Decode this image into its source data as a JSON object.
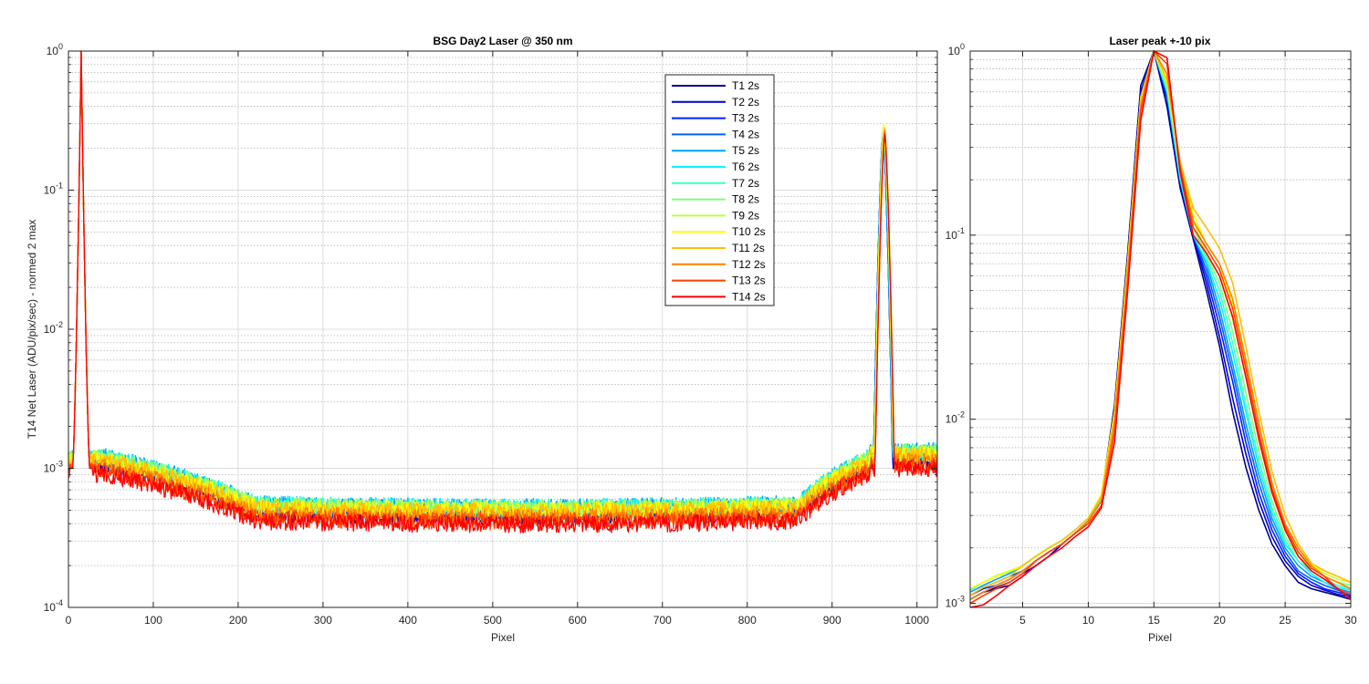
{
  "chart_data": [
    {
      "type": "line",
      "title": "BSG  Day2 Laser @ 350 nm",
      "xlabel": "Pixel",
      "ylabel": "T14 Net Laser (ADU/pix/sec) - normed 2 max",
      "xlim": [
        0,
        1024
      ],
      "ylim": [
        0.0001,
        1
      ],
      "yscale": "log",
      "grid": true,
      "minor_grid": true,
      "xticks": [
        0,
        100,
        200,
        300,
        400,
        500,
        600,
        700,
        800,
        900,
        1000
      ],
      "yticks": [
        {
          "base": "10",
          "exp": "-4",
          "value": 0.0001
        },
        {
          "base": "10",
          "exp": "-3",
          "value": 0.001
        },
        {
          "base": "10",
          "exp": "-2",
          "value": 0.01
        },
        {
          "base": "10",
          "exp": "-1",
          "value": 0.1
        },
        {
          "base": "10",
          "exp": "0",
          "value": 1
        }
      ],
      "legend_position": "top-center",
      "series": [
        {
          "name": "T1 2s",
          "color": "#00008f",
          "peak1_x": 15,
          "peak2_x": 960,
          "peak2_y": 0.25,
          "floor_y": 0.00048
        },
        {
          "name": "T2 2s",
          "color": "#0000cf",
          "peak1_x": 15,
          "peak2_x": 960,
          "peak2_y": 0.26,
          "floor_y": 0.0005
        },
        {
          "name": "T3 2s",
          "color": "#0020ff",
          "peak1_x": 15,
          "peak2_x": 960,
          "peak2_y": 0.25,
          "floor_y": 0.00052
        },
        {
          "name": "T4 2s",
          "color": "#0060ff",
          "peak1_x": 15,
          "peak2_x": 960,
          "peak2_y": 0.26,
          "floor_y": 0.00054
        },
        {
          "name": "T5 2s",
          "color": "#00a0ff",
          "peak1_x": 15,
          "peak2_x": 960,
          "peak2_y": 0.25,
          "floor_y": 0.00056
        },
        {
          "name": "T6 2s",
          "color": "#10f0ff",
          "peak1_x": 15,
          "peak2_x": 961,
          "peak2_y": 0.26,
          "floor_y": 0.00056
        },
        {
          "name": "T7 2s",
          "color": "#40ffbf",
          "peak1_x": 15,
          "peak2_x": 961,
          "peak2_y": 0.25,
          "floor_y": 0.00055
        },
        {
          "name": "T8 2s",
          "color": "#80ff7f",
          "peak1_x": 15,
          "peak2_x": 961,
          "peak2_y": 0.26,
          "floor_y": 0.00055
        },
        {
          "name": "T9 2s",
          "color": "#bfff40",
          "peak1_x": 15,
          "peak2_x": 961,
          "peak2_y": 0.27,
          "floor_y": 0.00054
        },
        {
          "name": "T10 2s",
          "color": "#ffff00",
          "peak1_x": 15,
          "peak2_x": 961,
          "peak2_y": 0.3,
          "floor_y": 0.00053
        },
        {
          "name": "T11 2s",
          "color": "#ffbf00",
          "peak1_x": 15,
          "peak2_x": 962,
          "peak2_y": 0.28,
          "floor_y": 0.00052
        },
        {
          "name": "T12 2s",
          "color": "#ff8000",
          "peak1_x": 15,
          "peak2_x": 962,
          "peak2_y": 0.27,
          "floor_y": 0.00047
        },
        {
          "name": "T13 2s",
          "color": "#ff4000",
          "peak1_x": 15,
          "peak2_x": 962,
          "peak2_y": 0.26,
          "floor_y": 0.00044
        },
        {
          "name": "T14 2s",
          "color": "#ff0000",
          "peak1_x": 15,
          "peak2_x": 962,
          "peak2_y": 0.25,
          "floor_y": 0.00042
        }
      ]
    },
    {
      "type": "line",
      "title": "Laser peak +-10 pix",
      "xlabel": "Pixel",
      "ylabel": "",
      "xlim": [
        1,
        30
      ],
      "ylim": [
        0.00095,
        1
      ],
      "yscale": "log",
      "grid": true,
      "minor_grid": true,
      "xticks": [
        5,
        10,
        15,
        20,
        25,
        30
      ],
      "yticks": [
        {
          "base": "10",
          "exp": "-3",
          "value": 0.001
        },
        {
          "base": "10",
          "exp": "-2",
          "value": 0.01
        },
        {
          "base": "10",
          "exp": "-1",
          "value": 0.1
        },
        {
          "base": "10",
          "exp": "0",
          "value": 1
        }
      ],
      "x": [
        1,
        2,
        3,
        4,
        5,
        6,
        7,
        8,
        9,
        10,
        11,
        12,
        13,
        14,
        15,
        16,
        17,
        18,
        19,
        20,
        21,
        22,
        23,
        24,
        25,
        26,
        27,
        28,
        29,
        30
      ],
      "series": [
        {
          "name": "T1 2s",
          "values": [
            0.00105,
            0.00115,
            0.0012,
            0.00125,
            0.0014,
            0.0016,
            0.0018,
            0.0021,
            0.0024,
            0.0028,
            0.0038,
            0.012,
            0.08,
            0.65,
            1.0,
            0.5,
            0.18,
            0.095,
            0.05,
            0.025,
            0.011,
            0.0055,
            0.0032,
            0.0021,
            0.0016,
            0.0013,
            0.0012,
            0.00115,
            0.0011,
            0.00105
          ]
        },
        {
          "name": "T2 2s",
          "values": [
            0.00105,
            0.00115,
            0.00122,
            0.0013,
            0.00145,
            0.0016,
            0.0018,
            0.0021,
            0.0024,
            0.0028,
            0.0037,
            0.011,
            0.07,
            0.6,
            1.0,
            0.55,
            0.19,
            0.1,
            0.055,
            0.028,
            0.013,
            0.0065,
            0.0036,
            0.0023,
            0.0017,
            0.0014,
            0.00125,
            0.00118,
            0.00112,
            0.00108
          ]
        },
        {
          "name": "T3 2s",
          "values": [
            0.0011,
            0.0012,
            0.00125,
            0.00135,
            0.0015,
            0.0017,
            0.0019,
            0.0021,
            0.0024,
            0.0028,
            0.0036,
            0.0105,
            0.065,
            0.58,
            1.0,
            0.57,
            0.2,
            0.1,
            0.06,
            0.032,
            0.016,
            0.0075,
            0.004,
            0.0025,
            0.0018,
            0.00145,
            0.0013,
            0.0012,
            0.00115,
            0.0011
          ]
        },
        {
          "name": "T4 2s",
          "values": [
            0.0011,
            0.00122,
            0.0013,
            0.0014,
            0.0015,
            0.0017,
            0.0019,
            0.0021,
            0.0024,
            0.0028,
            0.0036,
            0.01,
            0.062,
            0.55,
            1.0,
            0.58,
            0.2,
            0.1,
            0.065,
            0.036,
            0.018,
            0.0085,
            0.0045,
            0.0027,
            0.0019,
            0.0015,
            0.00135,
            0.00125,
            0.00118,
            0.00112
          ]
        },
        {
          "name": "T5 2s",
          "values": [
            0.00115,
            0.00125,
            0.00135,
            0.00145,
            0.0016,
            0.0018,
            0.002,
            0.0022,
            0.0025,
            0.0029,
            0.0037,
            0.0095,
            0.06,
            0.52,
            1.0,
            0.6,
            0.2,
            0.1,
            0.07,
            0.04,
            0.02,
            0.0095,
            0.005,
            0.0029,
            0.002,
            0.0016,
            0.0014,
            0.0013,
            0.0012,
            0.00115
          ]
        },
        {
          "name": "T6 2s",
          "values": [
            0.00118,
            0.0013,
            0.0014,
            0.0015,
            0.0016,
            0.0018,
            0.002,
            0.0022,
            0.0025,
            0.0029,
            0.0037,
            0.0095,
            0.06,
            0.5,
            1.0,
            0.6,
            0.2,
            0.1,
            0.072,
            0.045,
            0.023,
            0.011,
            0.0055,
            0.0031,
            0.0021,
            0.0017,
            0.00145,
            0.0013,
            0.00122,
            0.00118
          ]
        },
        {
          "name": "T7 2s",
          "values": [
            0.0012,
            0.0013,
            0.0014,
            0.0015,
            0.0016,
            0.0018,
            0.002,
            0.0022,
            0.0025,
            0.0029,
            0.0038,
            0.01,
            0.065,
            0.52,
            1.0,
            0.62,
            0.21,
            0.11,
            0.075,
            0.05,
            0.026,
            0.012,
            0.006,
            0.0033,
            0.0022,
            0.0017,
            0.0015,
            0.00135,
            0.00125,
            0.0012
          ]
        },
        {
          "name": "T8 2s",
          "values": [
            0.0012,
            0.0013,
            0.0014,
            0.00148,
            0.0016,
            0.0018,
            0.002,
            0.0022,
            0.0025,
            0.0029,
            0.0038,
            0.0105,
            0.07,
            0.55,
            1.0,
            0.64,
            0.22,
            0.11,
            0.078,
            0.055,
            0.03,
            0.014,
            0.0068,
            0.0036,
            0.0023,
            0.0018,
            0.00155,
            0.0014,
            0.0013,
            0.00125
          ]
        },
        {
          "name": "T9 2s",
          "values": [
            0.0012,
            0.0013,
            0.00142,
            0.0015,
            0.0016,
            0.0018,
            0.002,
            0.0022,
            0.0025,
            0.0029,
            0.0039,
            0.011,
            0.07,
            0.55,
            1.0,
            0.66,
            0.23,
            0.12,
            0.08,
            0.06,
            0.035,
            0.017,
            0.008,
            0.004,
            0.0025,
            0.0019,
            0.0016,
            0.00145,
            0.00135,
            0.0013
          ]
        },
        {
          "name": "T10 2s",
          "values": [
            0.0012,
            0.0013,
            0.0014,
            0.0015,
            0.0016,
            0.0018,
            0.002,
            0.0022,
            0.0025,
            0.0029,
            0.0039,
            0.011,
            0.072,
            0.56,
            1.0,
            0.68,
            0.24,
            0.13,
            0.09,
            0.07,
            0.042,
            0.02,
            0.0095,
            0.0045,
            0.0027,
            0.002,
            0.0016,
            0.0015,
            0.0014,
            0.0013
          ]
        },
        {
          "name": "T11 2s",
          "values": [
            0.0011,
            0.00122,
            0.0013,
            0.0014,
            0.0016,
            0.0018,
            0.002,
            0.0022,
            0.0025,
            0.0029,
            0.0038,
            0.0105,
            0.068,
            0.54,
            1.0,
            0.7,
            0.25,
            0.14,
            0.11,
            0.085,
            0.055,
            0.025,
            0.011,
            0.0052,
            0.003,
            0.0021,
            0.00165,
            0.0015,
            0.0014,
            0.0013
          ]
        },
        {
          "name": "T12 2s",
          "values": [
            0.00105,
            0.00115,
            0.00125,
            0.00135,
            0.0015,
            0.0017,
            0.0019,
            0.0021,
            0.0024,
            0.0028,
            0.0036,
            0.0095,
            0.06,
            0.5,
            1.0,
            0.75,
            0.24,
            0.12,
            0.09,
            0.07,
            0.045,
            0.021,
            0.0095,
            0.0045,
            0.0027,
            0.002,
            0.0016,
            0.0014,
            0.0013,
            0.0012
          ]
        },
        {
          "name": "T13 2s",
          "values": [
            0.001,
            0.0011,
            0.0012,
            0.0013,
            0.00145,
            0.0017,
            0.0019,
            0.0021,
            0.0024,
            0.0027,
            0.0034,
            0.0085,
            0.055,
            0.47,
            1.0,
            0.85,
            0.23,
            0.11,
            0.085,
            0.065,
            0.04,
            0.019,
            0.0085,
            0.0042,
            0.0026,
            0.0019,
            0.00155,
            0.0014,
            0.0012,
            0.00112
          ]
        },
        {
          "name": "T14 2s",
          "values": [
            0.00095,
            0.00098,
            0.0011,
            0.00125,
            0.0014,
            0.0016,
            0.0018,
            0.002,
            0.0023,
            0.0026,
            0.0033,
            0.0075,
            0.05,
            0.42,
            1.0,
            0.92,
            0.22,
            0.1,
            0.08,
            0.06,
            0.036,
            0.017,
            0.0078,
            0.004,
            0.0025,
            0.0018,
            0.0015,
            0.00135,
            0.0012,
            0.00105
          ]
        }
      ]
    }
  ]
}
